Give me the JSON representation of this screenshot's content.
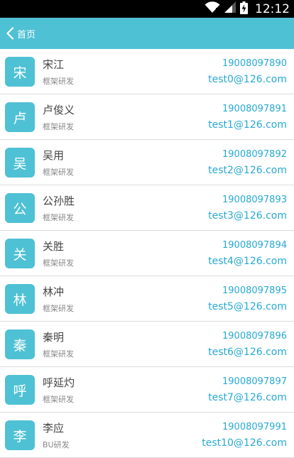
{
  "status_bar": {
    "time": "12:12",
    "icons": [
      "wifi-icon",
      "signal-icon",
      "battery-charging-icon"
    ]
  },
  "header": {
    "back_label": "首页",
    "accent_color": "#4fc1d4"
  },
  "contacts": [
    {
      "avatar": "宋",
      "name": "宋江",
      "dept": "框架研发",
      "phone": "19008097890",
      "email": "test0@126.com"
    },
    {
      "avatar": "卢",
      "name": "卢俊义",
      "dept": "框架研发",
      "phone": "19008097891",
      "email": "test1@126.com"
    },
    {
      "avatar": "吴",
      "name": "吴用",
      "dept": "框架研发",
      "phone": "19008097892",
      "email": "test2@126.com"
    },
    {
      "avatar": "公",
      "name": "公孙胜",
      "dept": "框架研发",
      "phone": "19008097893",
      "email": "test3@126.com"
    },
    {
      "avatar": "关",
      "name": "关胜",
      "dept": "框架研发",
      "phone": "19008097894",
      "email": "test4@126.com"
    },
    {
      "avatar": "林",
      "name": "林冲",
      "dept": "框架研发",
      "phone": "19008097895",
      "email": "test5@126.com"
    },
    {
      "avatar": "秦",
      "name": "秦明",
      "dept": "框架研发",
      "phone": "19008097896",
      "email": "test6@126.com"
    },
    {
      "avatar": "呼",
      "name": "呼延灼",
      "dept": "框架研发",
      "phone": "19008097897",
      "email": "test7@126.com"
    },
    {
      "avatar": "李",
      "name": "李应",
      "dept": "BU研发",
      "phone": "19008097991",
      "email": "test10@126.com"
    }
  ]
}
